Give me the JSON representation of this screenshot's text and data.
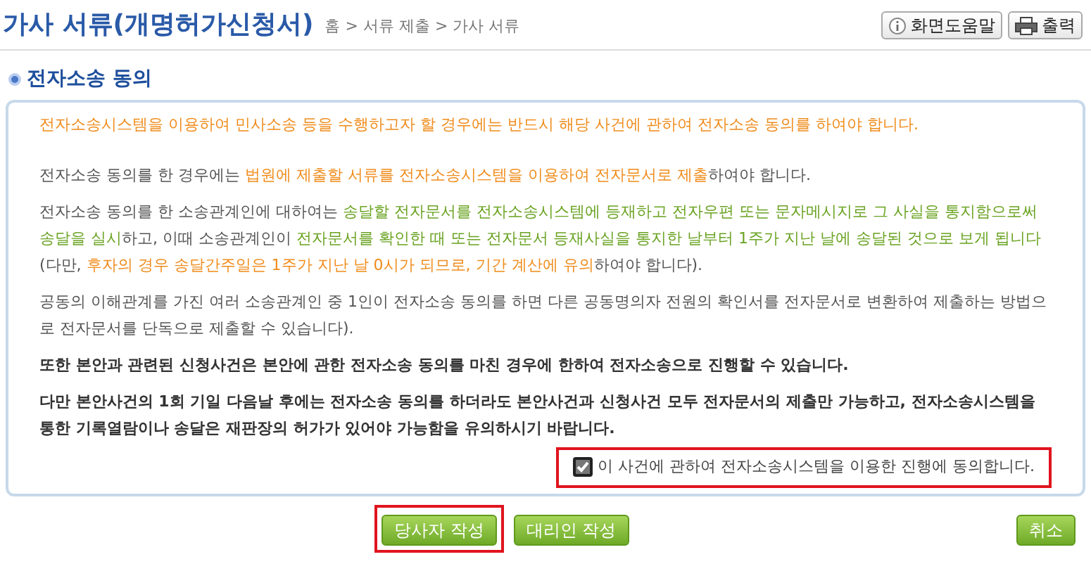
{
  "header": {
    "title": "가사 서류(개명허가신청서)",
    "breadcrumb": "홈 > 서류 제출 > 가사 서류",
    "buttons": [
      {
        "kind": "help",
        "label": "화면도움말"
      },
      {
        "kind": "print",
        "label": "출력"
      }
    ]
  },
  "section": {
    "title": "전자소송 동의"
  },
  "paragraphs": [
    {
      "kind": "normal",
      "segments": [
        {
          "text": "전자소송시스템을 이용하여 민사소송 등을 수행하고자 할 경우에는 반드시 해당 사건에 관하여 전자소송 동의를 하여야 합니다.",
          "color": "#f08c1c"
        }
      ]
    },
    {
      "kind": "normal",
      "segments": [
        {
          "text": "전자소송 동의를 한 경우에는 ",
          "color": "#555555"
        },
        {
          "text": "법원에 제출할 서류를 전자소송시스템을 이용하여 전자문서로 제출",
          "color": "#f08c1c"
        },
        {
          "text": "하여야 합니다.",
          "color": "#555555"
        }
      ]
    },
    {
      "kind": "normal",
      "segments": [
        {
          "text": "전자소송 동의를 한 소송관계인에 대하여는 ",
          "color": "#555555"
        },
        {
          "text": "송달할 전자문서를 전자소송시스템에 등재하고 전자우편 또는 문자메시지로 그 사실을 통지함으로써 송달을 실시",
          "color": "#6aa322"
        },
        {
          "text": "하고, 이때 소송관계인이 ",
          "color": "#555555"
        },
        {
          "text": "전자문서를 확인한 때 또는 전자문서 등재사실을 통지한 날부터 1주가 지난 날에 송달된 것으로 보게 됩니다",
          "color": "#6aa322"
        },
        {
          "text": "(다만, ",
          "color": "#555555"
        },
        {
          "text": "후자의 경우 송달간주일은 1주가 지난 날 0시가 되므로, 기간 계산에 유의",
          "color": "#f08c1c"
        },
        {
          "text": "하여야 합니다).",
          "color": "#555555"
        }
      ]
    },
    {
      "kind": "normal",
      "segments": [
        {
          "text": "공동의 이해관계를 가진 여러 소송관계인 중 1인이 전자소송 동의를 하면 다른 공동명의자 전원의 확인서를 전자문서로 변환하여 제출하는 방법으로 전자문서를 단독으로 제출할 수 있습니다).",
          "color": "#555555"
        }
      ]
    },
    {
      "kind": "bold",
      "segments": [
        {
          "text": "또한 본안과 관련된 신청사건은 본안에 관한 전자소송 동의를 마친 경우에 한하여 전자소송으로 진행할 수 있습니다.",
          "color": "#333333"
        }
      ]
    },
    {
      "kind": "bold",
      "segments": [
        {
          "text": "다만 본안사건의 1회 기일 다음날 후에는 전자소송 동의를 하더라도 본안사건과 신청사건 모두 전자문서의 제출만 가능하고, 전자소송시스템을 통한 기록열람이나 송달은 재판장의 허가가 있어야 가능함을 유의하시기 바랍니다.",
          "color": "#333333"
        }
      ]
    }
  ],
  "consent": {
    "label": "이 사건에 관하여 전자소송시스템을 이용한 진행에 동의합니다.",
    "checked": true,
    "highlighted": true
  },
  "actions": [
    {
      "label": "당사자 작성",
      "highlighted": true
    },
    {
      "label": "대리인 작성",
      "highlighted": false
    },
    {
      "label": "취소",
      "highlighted": false
    }
  ]
}
